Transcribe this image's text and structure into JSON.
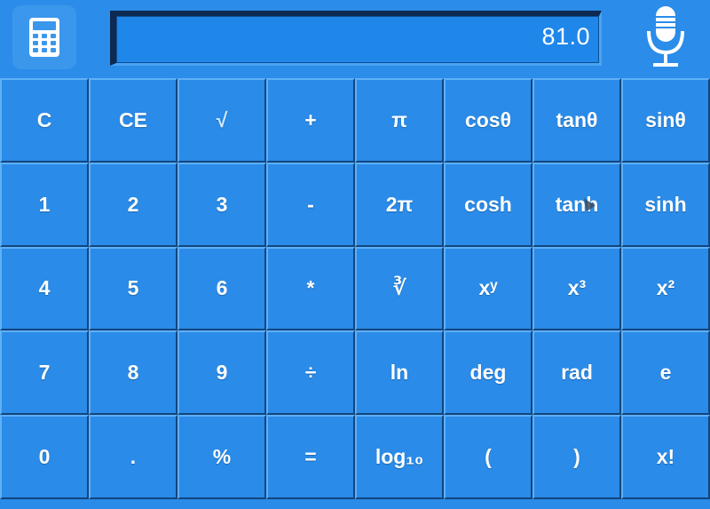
{
  "display": {
    "value": "81.0"
  },
  "icons": {
    "calculator": "calculator-icon",
    "microphone": "microphone-icon"
  },
  "colors": {
    "background": "#2a8be8",
    "display_bg": "#1f86ea",
    "display_border": "#0c2a52",
    "key_text": "#ffffff"
  },
  "keys": [
    [
      "C",
      "CE",
      "√",
      "+",
      "π",
      "cosθ",
      "tanθ",
      "sinθ"
    ],
    [
      "1",
      "2",
      "3",
      "-",
      "2π",
      "cosh",
      "tanh",
      "sinh"
    ],
    [
      "4",
      "5",
      "6",
      "*",
      "∛",
      "xʸ",
      "x³",
      "x²"
    ],
    [
      "7",
      "8",
      "9",
      "÷",
      "ln",
      "deg",
      "rad",
      "e"
    ],
    [
      "0",
      ".",
      "%",
      "=",
      "log₁₀",
      "(",
      ")",
      "x!"
    ]
  ]
}
